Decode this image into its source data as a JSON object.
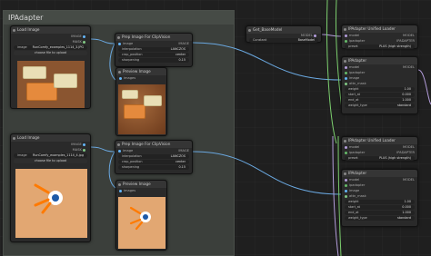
{
  "group": {
    "title": "IPAdapter"
  },
  "load_image_1": {
    "title": "Load Image",
    "out_image": "IMAGE",
    "out_mask": "MASK",
    "image_label": "image",
    "image_value": "RunComfy_examples_1114_3.JPG",
    "upload_label": "choose file to upload"
  },
  "load_image_2": {
    "title": "Load Image",
    "out_image": "IMAGE",
    "out_mask": "MASK",
    "image_label": "image",
    "image_value": "RunComfy_examples_1114_4.jpg",
    "upload_label": "choose file to upload"
  },
  "prep_1": {
    "title": "Prep Image For ClipVision",
    "in_image": "image",
    "out_image": "IMAGE",
    "interpolation_label": "interpolation",
    "interpolation_value": "LANCZOS",
    "crop_label": "crop_position",
    "crop_value": "center",
    "sharpening_label": "sharpening",
    "sharpening_value": "0.15"
  },
  "prep_2": {
    "title": "Prep Image For ClipVision",
    "in_image": "image",
    "out_image": "IMAGE",
    "interpolation_label": "interpolation",
    "interpolation_value": "LANCZOS",
    "crop_label": "crop_position",
    "crop_value": "center",
    "sharpening_label": "sharpening",
    "sharpening_value": "0.15"
  },
  "preview_1": {
    "title": "Preview Image",
    "in_images": "images"
  },
  "preview_2": {
    "title": "Preview Image",
    "in_images": "images"
  },
  "get_basemodel": {
    "title": "Get_BaseModel",
    "out_model": "MODEL",
    "constant_label": "Constant",
    "constant_value": "BaseModel"
  },
  "unified_loader_1": {
    "title": "IPAdapter Unified Loader",
    "in_model": "model",
    "in_ipadapter": "ipadapter",
    "out_model": "MODEL",
    "out_ipadapter": "IPADAPTER",
    "preset_label": "preset",
    "preset_value": "PLUS (high strength)"
  },
  "unified_loader_2": {
    "title": "IPAdapter Unified Loader",
    "in_model": "model",
    "in_ipadapter": "ipadapter",
    "out_model": "MODEL",
    "out_ipadapter": "IPADAPTER",
    "preset_label": "preset",
    "preset_value": "PLUS (high strength)"
  },
  "ipadapter_1": {
    "title": "IPAdapter",
    "inputs": [
      "model",
      "ipadapter",
      "image",
      "attn_mask"
    ],
    "out_model": "MODEL",
    "widgets": [
      {
        "label": "weight",
        "value": "1.00"
      },
      {
        "label": "start_at",
        "value": "0.000"
      },
      {
        "label": "end_at",
        "value": "1.000"
      },
      {
        "label": "weight_type",
        "value": "standard"
      }
    ]
  },
  "ipadapter_2": {
    "title": "IPAdapter",
    "inputs": [
      "model",
      "ipadapter",
      "image",
      "attn_mask"
    ],
    "out_model": "MODEL",
    "widgets": [
      {
        "label": "weight",
        "value": "1.00"
      },
      {
        "label": "start_at",
        "value": "0.000"
      },
      {
        "label": "end_at",
        "value": "1.000"
      },
      {
        "label": "weight_type",
        "value": "standard"
      }
    ]
  },
  "colors": {
    "image_wire": "#6aa8e0",
    "model_wire": "#b39ddb",
    "ipadapter_wire": "#7ccf6e",
    "image_dot": "#64b5f6",
    "model_dot": "#b39ddb",
    "ipadapter_dot": "#66bb6a",
    "mask_dot": "#81c784"
  }
}
